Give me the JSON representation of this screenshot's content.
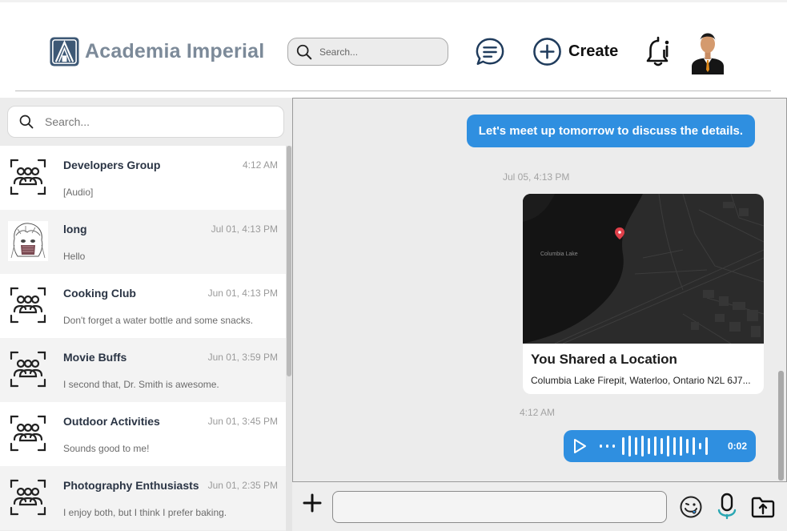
{
  "header": {
    "app_name": "Academia Imperial",
    "search": {
      "placeholder": "Search..."
    },
    "create_label": "Create"
  },
  "sidebar": {
    "search": {
      "placeholder": "Search..."
    },
    "conversations": [
      {
        "name": "Developers Group",
        "time": "4:12 AM",
        "preview": "[Audio]",
        "avatar": "group-icon"
      },
      {
        "name": "long",
        "time": "Jul 01, 4:13 PM",
        "preview": "Hello",
        "avatar": "anime-avatar"
      },
      {
        "name": "Cooking Club",
        "time": "Jun 01, 4:13 PM",
        "preview": "Don't forget a water bottle and some snacks.",
        "avatar": "group-icon"
      },
      {
        "name": "Movie Buffs",
        "time": "Jun 01, 3:59 PM",
        "preview": "I second that, Dr. Smith is awesome.",
        "avatar": "group-icon"
      },
      {
        "name": "Outdoor Activities",
        "time": "Jun 01, 3:45 PM",
        "preview": "Sounds good to me!",
        "avatar": "group-icon"
      },
      {
        "name": "Photography Enthusiasts",
        "time": "Jun 01, 2:35 PM",
        "preview": "I enjoy both, but I think I prefer baking.",
        "avatar": "group-icon"
      }
    ]
  },
  "chat": {
    "messages": {
      "text_message": "Let's meet up tomorrow to discuss the details.",
      "location_timestamp": "Jul 05, 4:13 PM",
      "location": {
        "title": "You Shared a Location",
        "address": "Columbia Lake Firepit, Waterloo, Ontario N2L 6J7...",
        "map_label": "Columbia Lake"
      },
      "audio_timestamp": "4:12 AM",
      "audio_duration": "0:02"
    },
    "composer": {
      "placeholder": ""
    }
  },
  "colors": {
    "accent": "#2f8fe0",
    "brand_text": "#7c8a99",
    "sidebar_bg": "#ececec",
    "map_pin": "#e0404a"
  }
}
